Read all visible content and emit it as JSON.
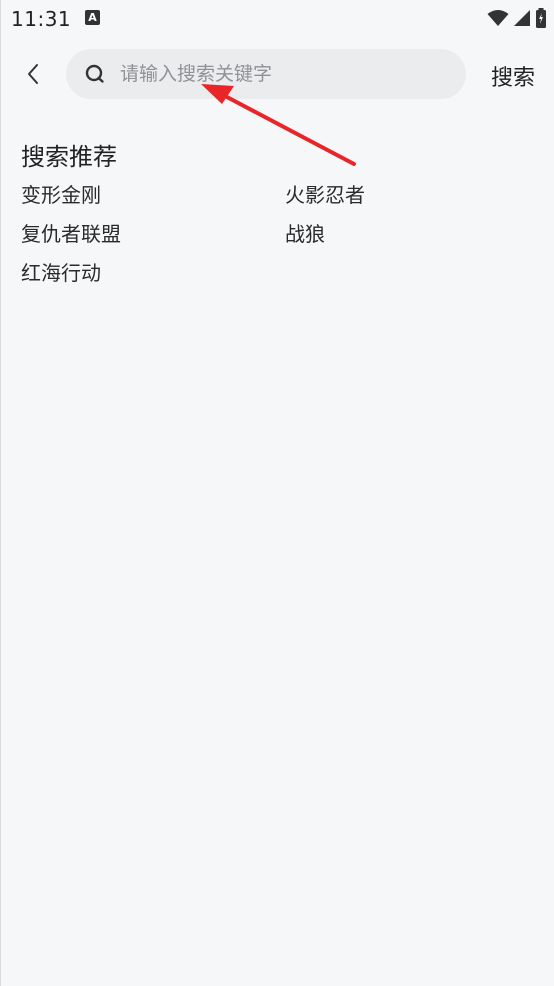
{
  "status_bar": {
    "time": "11:31",
    "notification_icon_letter": "A",
    "icons": [
      "wifi-icon",
      "cell-signal-icon",
      "battery-icon"
    ]
  },
  "search": {
    "placeholder": "请输入搜索关键字",
    "value": "",
    "button_label": "搜索"
  },
  "recommend": {
    "title": "搜索推荐",
    "items": [
      {
        "label": "变形金刚"
      },
      {
        "label": "火影忍者"
      },
      {
        "label": "复仇者联盟"
      },
      {
        "label": "战狼"
      },
      {
        "label": "红海行动"
      }
    ]
  },
  "colors": {
    "background": "#f6f7f9",
    "search_box": "#ebecee",
    "annotation_arrow": "#e8262a"
  }
}
